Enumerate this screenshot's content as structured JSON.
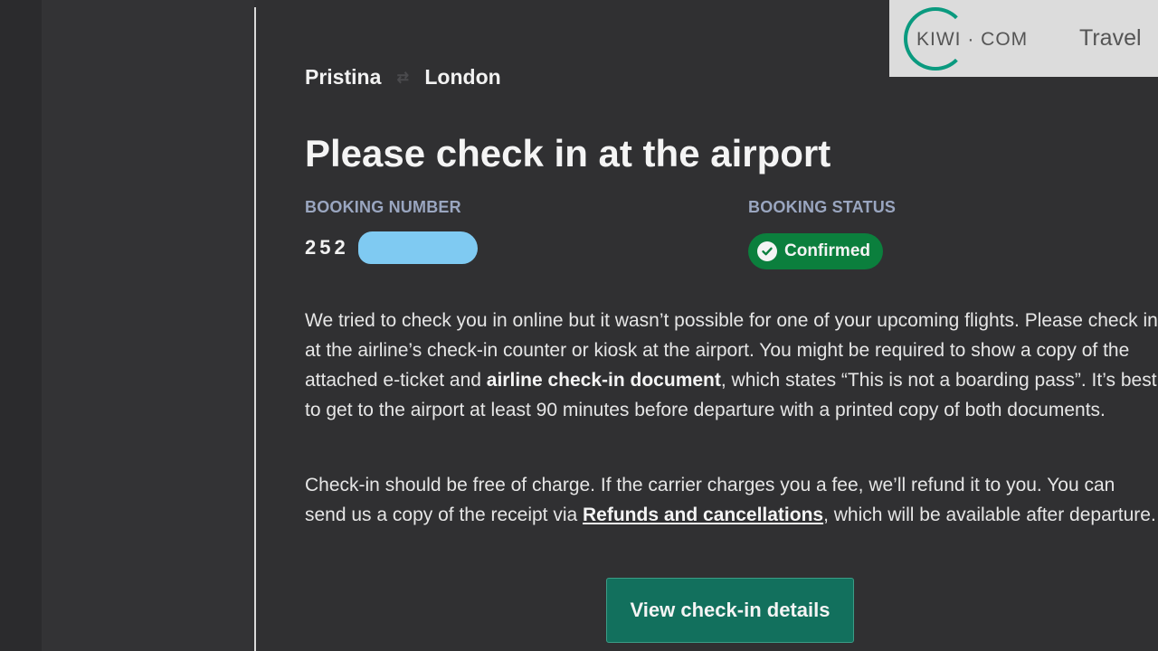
{
  "route": {
    "origin": "Pristina",
    "destination": "London",
    "arrow_icon": "plane-arrow-icon"
  },
  "title": "Please check in at the airport",
  "booking": {
    "number_label": "BOOKING NUMBER",
    "number_visible": "252",
    "status_label": "BOOKING STATUS",
    "status_value": "Confirmed",
    "status_color": "#0b7f3d"
  },
  "message": {
    "p1_part1": "We tried to check you in online but it wasn’t possible for one of your upcoming flights. Please check in at the airline’s check-in counter or kiosk at the airport. You might be required to show a copy of the attached e-ticket and ",
    "p1_bold": "airline check-in document",
    "p1_part2": ", which states “This is not a boarding pass”. It’s best to get to the airport at least 90 minutes before departure with a printed copy of both documents.",
    "p2_part1": "Check-in should be free of charge. If the carrier charges you a fee, we’ll refund it to you. You can send us a copy of the receipt via ",
    "p2_link": "Refunds and cancellations",
    "p2_part2": ", which will be available after departure."
  },
  "cta": {
    "label": "View check-in details",
    "color": "#12705d"
  },
  "watermark": {
    "logo_text": "KIWI · COM",
    "suffix": "Travel",
    "accent": "#0a9a7f"
  }
}
